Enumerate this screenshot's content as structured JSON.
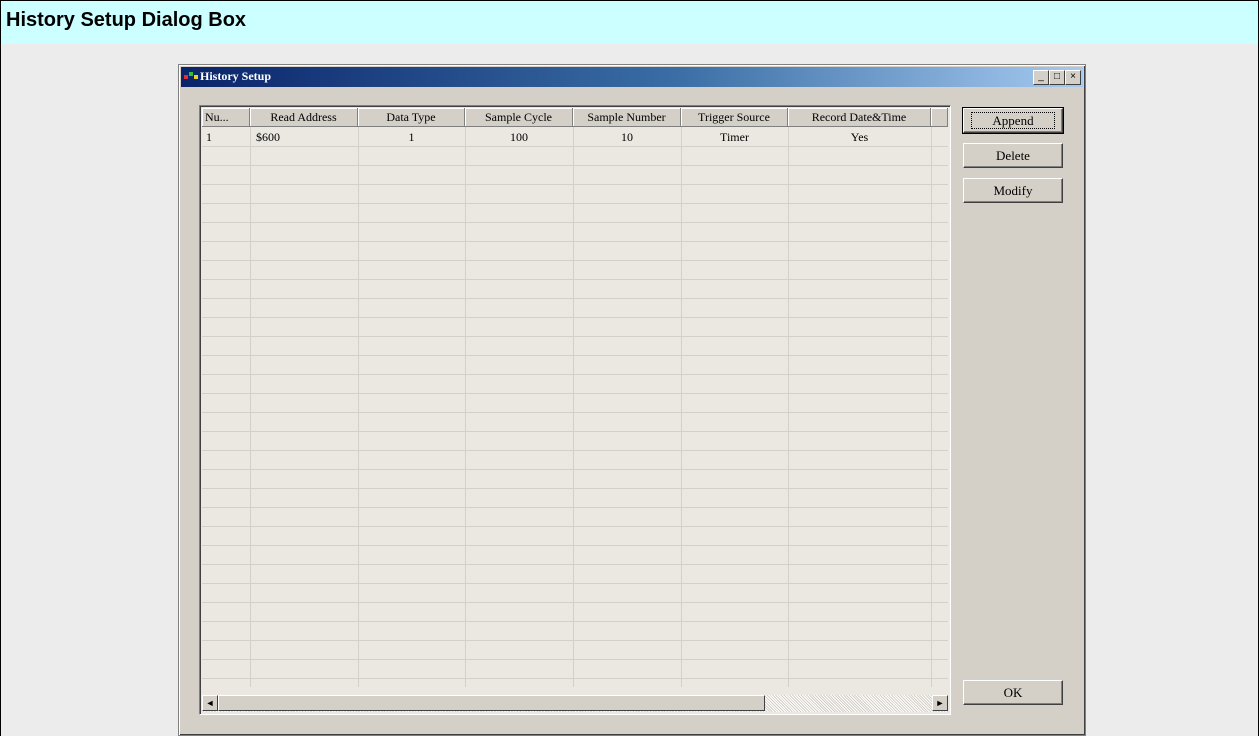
{
  "page": {
    "title": "History Setup Dialog Box"
  },
  "dialog": {
    "title": "History Setup",
    "buttons": {
      "minimize": "_",
      "maximize": "□",
      "close": "×",
      "append": "Append",
      "delete": "Delete",
      "modify": "Modify",
      "ok": "OK"
    },
    "columns": [
      "Nu...",
      "Read Address",
      "Data Type",
      "Sample Cycle",
      "Sample Number",
      "Trigger Source",
      "Record Date&Time",
      ""
    ],
    "rows": [
      [
        "1",
        "$600",
        "1",
        "100",
        "10",
        "Timer",
        "Yes"
      ]
    ],
    "scroll_arrows": {
      "left": "◄",
      "right": "►"
    }
  }
}
